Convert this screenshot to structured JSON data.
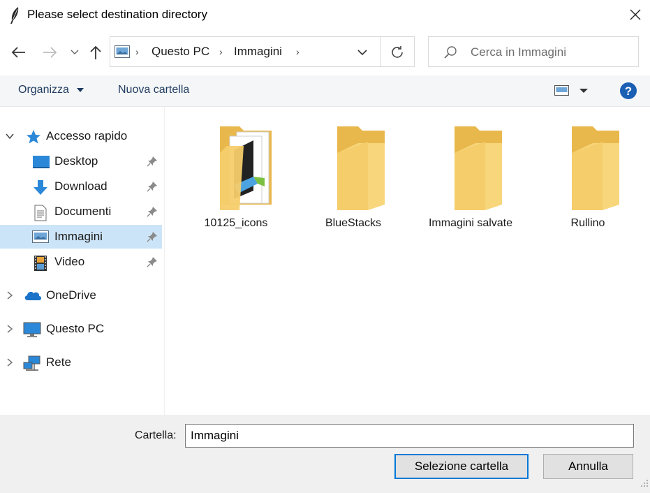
{
  "window": {
    "title": "Please select destination directory"
  },
  "address": {
    "crumbs": [
      "Questo PC",
      "Immagini"
    ]
  },
  "search": {
    "placeholder": "Cerca in Immagini"
  },
  "toolbar": {
    "organize_label": "Organizza",
    "new_folder_label": "Nuova cartella"
  },
  "sidebar": {
    "items": [
      {
        "label": "Accesso rapido",
        "icon": "star-icon",
        "pinned": false,
        "selected": false
      },
      {
        "label": "Desktop",
        "icon": "desktop-icon",
        "pinned": true,
        "selected": false
      },
      {
        "label": "Download",
        "icon": "download-icon",
        "pinned": true,
        "selected": false
      },
      {
        "label": "Documenti",
        "icon": "document-icon",
        "pinned": true,
        "selected": false
      },
      {
        "label": "Immagini",
        "icon": "pictures-icon",
        "pinned": true,
        "selected": true
      },
      {
        "label": "Video",
        "icon": "video-icon",
        "pinned": true,
        "selected": false
      },
      {
        "label": "OneDrive",
        "icon": "cloud-icon",
        "pinned": false,
        "selected": false
      },
      {
        "label": "Questo PC",
        "icon": "computer-icon",
        "pinned": false,
        "selected": false
      },
      {
        "label": "Rete",
        "icon": "network-icon",
        "pinned": false,
        "selected": false
      }
    ]
  },
  "folders": [
    {
      "name": "10125_icons",
      "icon": "folder-with-images-icon"
    },
    {
      "name": "BlueStacks",
      "icon": "folder-icon"
    },
    {
      "name": "Immagini salvate",
      "icon": "folder-icon"
    },
    {
      "name": "Rullino",
      "icon": "folder-icon"
    }
  ],
  "footer": {
    "folder_label": "Cartella:",
    "folder_value": "Immagini",
    "select_button": "Selezione cartella",
    "cancel_button": "Annulla"
  },
  "colors": {
    "accent": "#0078d7",
    "selected_bg": "#cce4f7",
    "folder_yellow": "#f5cd6b",
    "help_blue": "#1a5fb4"
  }
}
